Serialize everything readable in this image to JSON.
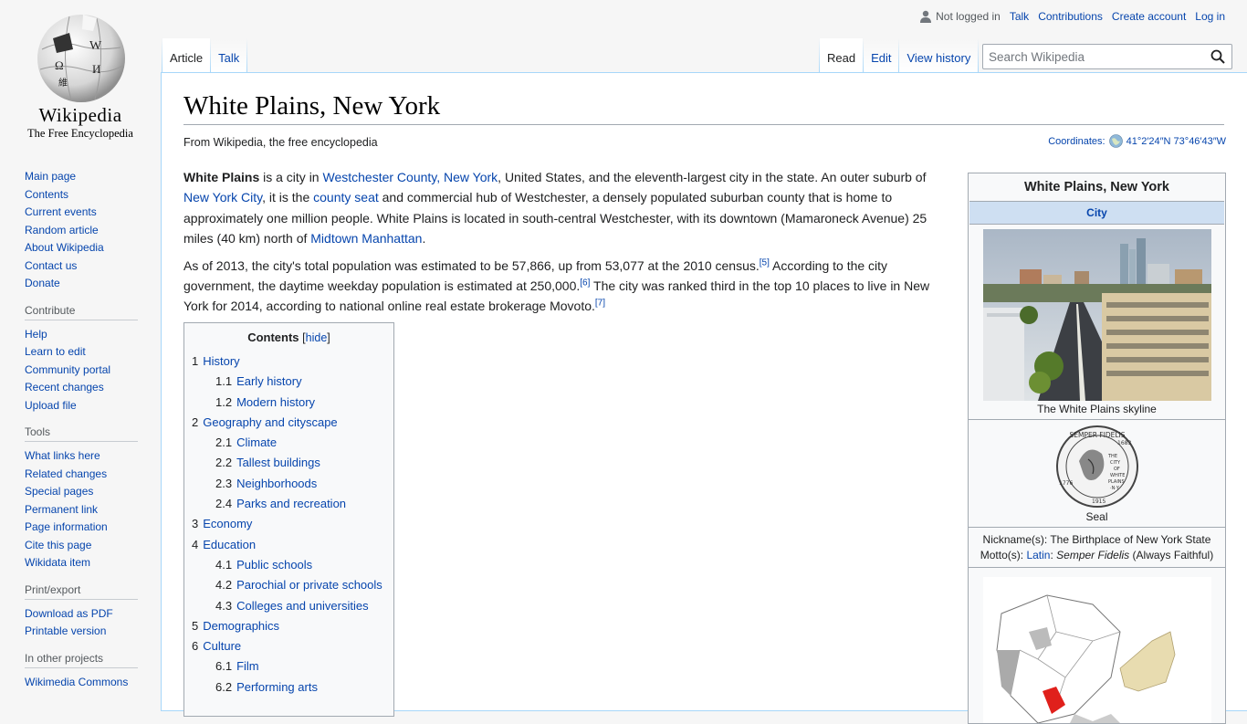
{
  "logo": {
    "wordmark": "Wikipedia",
    "tagline": "The Free Encyclopedia"
  },
  "personal": {
    "not_logged_in": "Not logged in",
    "talk": "Talk",
    "contributions": "Contributions",
    "create_account": "Create account",
    "login": "Log in"
  },
  "tabs": {
    "article": "Article",
    "talk": "Talk",
    "read": "Read",
    "edit": "Edit",
    "history": "View history"
  },
  "search": {
    "placeholder": "Search Wikipedia"
  },
  "sidebar": {
    "main": [
      "Main page",
      "Contents",
      "Current events",
      "Random article",
      "About Wikipedia",
      "Contact us",
      "Donate"
    ],
    "contribute": {
      "heading": "Contribute",
      "items": [
        "Help",
        "Learn to edit",
        "Community portal",
        "Recent changes",
        "Upload file"
      ]
    },
    "tools": {
      "heading": "Tools",
      "items": [
        "What links here",
        "Related changes",
        "Special pages",
        "Permanent link",
        "Page information",
        "Cite this page",
        "Wikidata item"
      ]
    },
    "print": {
      "heading": "Print/export",
      "items": [
        "Download as PDF",
        "Printable version"
      ]
    },
    "projects": {
      "heading": "In other projects",
      "items": [
        "Wikimedia Commons"
      ]
    }
  },
  "article": {
    "title": "White Plains, New York",
    "from": "From Wikipedia, the free encyclopedia",
    "coords_label": "Coordinates:",
    "coords": "41°2′24″N 73°46′43″W",
    "p1": {
      "bold": "White Plains",
      "t1": " is a city in ",
      "l1": "Westchester County, New York",
      "t2": ", United States, and the eleventh-largest city in the state. An outer suburb of ",
      "l2": "New York City",
      "t3": ", it is the ",
      "l3": "county seat",
      "t4": " and commercial hub of Westchester, a densely populated suburban county that is home to approximately one million people. White Plains is located in south-central Westchester, with its downtown (Mamaroneck Avenue) 25 miles (40 km) north of ",
      "l4": "Midtown Manhattan",
      "t5": "."
    },
    "p2": {
      "t1": "As of 2013, the city's total population was estimated to be 57,866, up from 53,077 at the 2010 census.",
      "r1": "[5]",
      "t2": " According to the city government, the daytime weekday population is estimated at 250,000.",
      "r2": "[6]",
      "t3": " The city was ranked third in the top 10 places to live in New York for 2014, according to national online real estate brokerage Movoto.",
      "r3": "[7]"
    }
  },
  "toc": {
    "title": "Contents",
    "hide": "hide",
    "items": [
      {
        "num": "1",
        "text": "History",
        "level": 1
      },
      {
        "num": "1.1",
        "text": "Early history",
        "level": 2
      },
      {
        "num": "1.2",
        "text": "Modern history",
        "level": 2
      },
      {
        "num": "2",
        "text": "Geography and cityscape",
        "level": 1
      },
      {
        "num": "2.1",
        "text": "Climate",
        "level": 2
      },
      {
        "num": "2.2",
        "text": "Tallest buildings",
        "level": 2
      },
      {
        "num": "2.3",
        "text": "Neighborhoods",
        "level": 2
      },
      {
        "num": "2.4",
        "text": "Parks and recreation",
        "level": 2
      },
      {
        "num": "3",
        "text": "Economy",
        "level": 1
      },
      {
        "num": "4",
        "text": "Education",
        "level": 1
      },
      {
        "num": "4.1",
        "text": "Public schools",
        "level": 2
      },
      {
        "num": "4.2",
        "text": "Parochial or private schools",
        "level": 2
      },
      {
        "num": "4.3",
        "text": "Colleges and universities",
        "level": 2
      },
      {
        "num": "5",
        "text": "Demographics",
        "level": 1
      },
      {
        "num": "6",
        "text": "Culture",
        "level": 1
      },
      {
        "num": "6.1",
        "text": "Film",
        "level": 2
      },
      {
        "num": "6.2",
        "text": "Performing arts",
        "level": 2
      }
    ]
  },
  "infobox": {
    "title": "White Plains, New York",
    "type": "City",
    "photo_caption": "The White Plains skyline",
    "seal_caption": "Seal",
    "seal_text": {
      "motto": "SEMPER FIDELIS",
      "year_top": "1683",
      "center": [
        "THE",
        "CITY",
        "OF",
        "WHITE",
        "PLAINS",
        "·N·Y·"
      ],
      "year_left": "1776",
      "year_bottom": "1915"
    },
    "nickname_label": "Nickname(s):",
    "nickname": "The Birthplace of New York State",
    "motto_label": "Motto(s):",
    "motto_lang": "Latin",
    "motto_sep": ": ",
    "motto": "Semper Fidelis",
    "motto_tr": " (Always Faithful)"
  },
  "colors": {
    "link": "#0645ad",
    "border": "#a7d7f9",
    "infobox_header": "#cedff2",
    "map_highlight": "#e0201b",
    "map_state": "#e8dcb0"
  }
}
